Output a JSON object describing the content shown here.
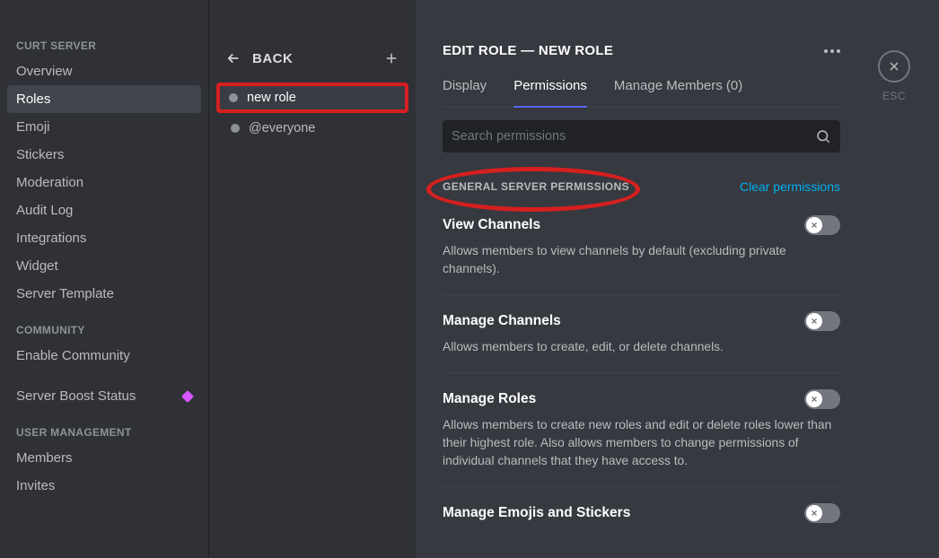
{
  "sidebar": {
    "server_name": "CURT SERVER",
    "groups": [
      {
        "items": [
          "Overview",
          "Roles",
          "Emoji",
          "Stickers",
          "Moderation",
          "Audit Log",
          "Integrations",
          "Widget",
          "Server Template"
        ],
        "active": "Roles"
      },
      {
        "header": "COMMUNITY",
        "items": [
          "Enable Community"
        ]
      },
      {
        "items": [
          "Server Boost Status"
        ],
        "boost": true
      },
      {
        "header": "USER MANAGEMENT",
        "items": [
          "Members",
          "Invites"
        ]
      }
    ]
  },
  "roles_col": {
    "back_label": "BACK",
    "roles": [
      "new role",
      "@everyone"
    ],
    "selected": "new role"
  },
  "main": {
    "title": "EDIT ROLE — NEW ROLE",
    "tabs": {
      "display": "Display",
      "permissions": "Permissions",
      "members": "Manage Members (0)",
      "active": "permissions"
    },
    "search_placeholder": "Search permissions",
    "section_label": "GENERAL SERVER PERMISSIONS",
    "clear_label": "Clear permissions",
    "perms": [
      {
        "title": "View Channels",
        "desc": "Allows members to view channels by default (excluding private channels)."
      },
      {
        "title": "Manage Channels",
        "desc": "Allows members to create, edit, or delete channels."
      },
      {
        "title": "Manage Roles",
        "desc": "Allows members to create new roles and edit or delete roles lower than their highest role. Also allows members to change permissions of individual channels that they have access to."
      },
      {
        "title": "Manage Emojis and Stickers",
        "desc": ""
      }
    ]
  },
  "close": {
    "esc": "ESC"
  }
}
